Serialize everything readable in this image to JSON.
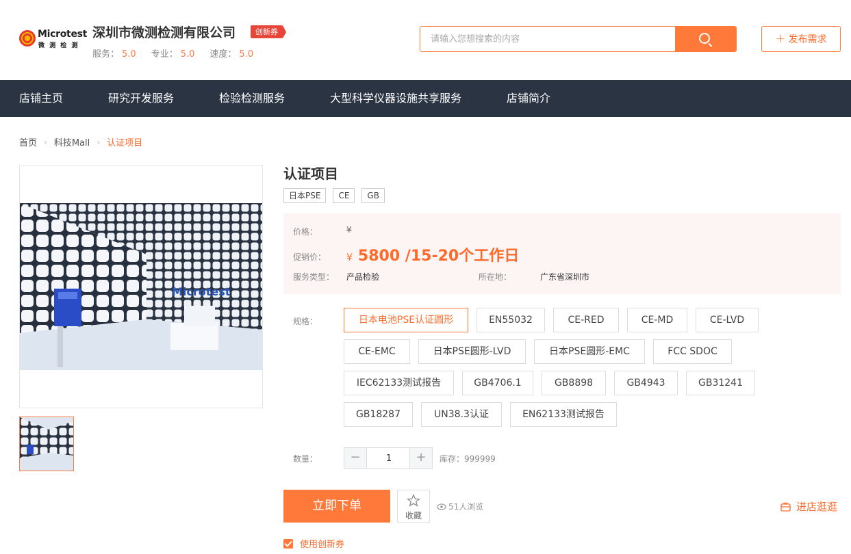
{
  "store": {
    "logo_text": "Microtest",
    "logo_subtext": "微 测 检 测",
    "name": "深圳市微测检测有限公司",
    "badge": "创新券",
    "ratings": [
      {
        "label": "服务：",
        "value": "5.0"
      },
      {
        "label": "专业：",
        "value": "5.0"
      },
      {
        "label": "速度：",
        "value": "5.0"
      }
    ]
  },
  "search": {
    "placeholder": "请输入您想搜索的内容",
    "value": ""
  },
  "publish_label": "发布需求",
  "nav": [
    "店铺主页",
    "研究开发服务",
    "检验检测服务",
    "大型科学仪器设施共享服务",
    "店铺简介"
  ],
  "breadcrumb": [
    "首页",
    "科技Mall",
    "认证项目"
  ],
  "product": {
    "title": "认证项目",
    "tags": [
      "日本PSE",
      "CE",
      "GB"
    ],
    "price_label": "价格：",
    "price_value": "¥",
    "promo_label": "促销价：",
    "promo_currency": "¥",
    "promo_value": "5800 /15-20个工作日",
    "service_type_label": "服务类型：",
    "service_type": "产品检验",
    "location_label": "所在地：",
    "location": "广东省深圳市",
    "photo_watermark": "Microtest"
  },
  "specs": {
    "label": "规格：",
    "selected": "日本电池PSE认证圆形",
    "rows": [
      [
        "日本电池PSE认证圆形",
        "EN55032",
        "CE-RED",
        "CE-MD",
        "CE-LVD"
      ],
      [
        "CE-EMC",
        "日本PSE圆形-LVD",
        "日本PSE圆形-EMC",
        "FCC SDOC"
      ],
      [
        "IEC62133测试报告",
        "GB4706.1",
        "GB8898",
        "GB4943",
        "GB31241"
      ],
      [
        "GB18287",
        "UN38.3认证",
        "EN62133测试报告"
      ]
    ]
  },
  "quantity": {
    "label": "数量：",
    "value": "1",
    "minus": "−",
    "plus": "+",
    "stock": "库存：999999"
  },
  "actions": {
    "buy": "立即下单",
    "favorite": "收藏",
    "views": "51人浏览",
    "visit_store": "进店逛逛",
    "use_coupon": "使用创新券"
  },
  "colors": {
    "accent": "#ff7a3a",
    "nav_bg": "#2a3442",
    "price_bg": "#fcf5f3"
  }
}
